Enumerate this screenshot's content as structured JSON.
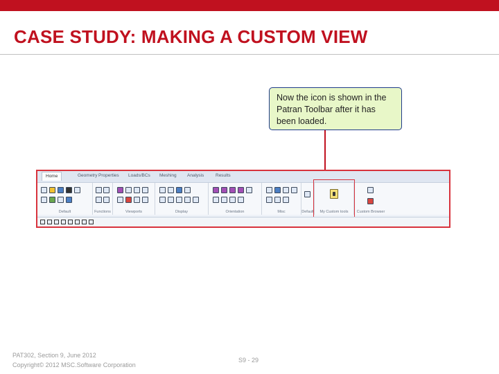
{
  "slide": {
    "title": "CASE STUDY: MAKING A CUSTOM VIEW",
    "callout": "Now the icon is shown in the Patran Toolbar after it has been loaded.",
    "accent_color": "#c0111f",
    "callout_fill": "#e8f7c8",
    "callout_border": "#1f3a8a"
  },
  "toolbar": {
    "tabs": [
      "Home",
      "Geometry",
      "Properties",
      "Loads/BCs",
      "Meshing",
      "Analysis",
      "Results"
    ],
    "active_tab": "Home",
    "groups": [
      "Default",
      "Functions",
      "Viewports",
      "Display",
      "Orientation",
      "Misc",
      "Default",
      "My Custom tools",
      "Custom Browser"
    ],
    "new_icon": "custom-tool-icon",
    "highlight_color": "#d8323c"
  },
  "footer": {
    "course": "PAT302, Section 9, June 2012",
    "copyright": "Copyright© 2012 MSC.Software Corporation",
    "page": "S9 - 29"
  }
}
